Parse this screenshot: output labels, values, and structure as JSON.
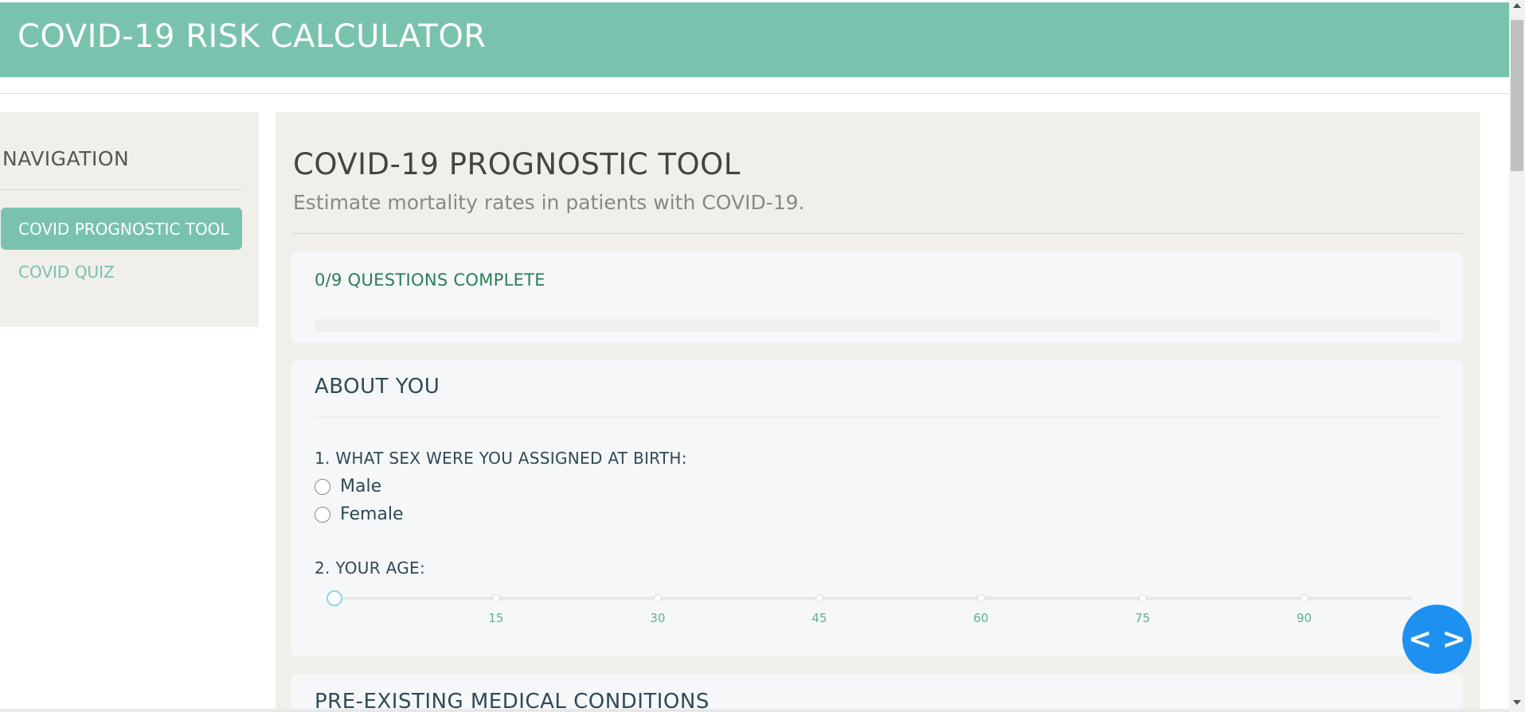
{
  "header": {
    "title": "COVID-19 RISK CALCULATOR"
  },
  "sidebar": {
    "heading": "NAVIGATION",
    "items": [
      {
        "label": "COVID PROGNOSTIC TOOL",
        "active": true
      },
      {
        "label": "COVID QUIZ",
        "active": false
      }
    ]
  },
  "main": {
    "title": "COVID-19 PROGNOSTIC TOOL",
    "subtitle": "Estimate mortality rates in patients with COVID-19.",
    "progress": {
      "label": "0/9 QUESTIONS COMPLETE",
      "fraction": 0
    },
    "sections": [
      {
        "title": "ABOUT YOU",
        "questions": [
          {
            "label": "1. WHAT SEX WERE YOU ASSIGNED AT BIRTH:",
            "options": [
              "Male",
              "Female"
            ]
          },
          {
            "label": "2. YOUR AGE:",
            "ticks": [
              "15",
              "30",
              "45",
              "60",
              "75",
              "90"
            ],
            "value": 0
          }
        ]
      },
      {
        "title": "PRE-EXISTING MEDICAL CONDITIONS"
      }
    ]
  },
  "fab": {
    "icon": "code-icon",
    "glyph": "< >",
    "color": "#1e90f0"
  },
  "colors": {
    "accent": "#79c2ae",
    "progress_text": "#2e7d55"
  }
}
